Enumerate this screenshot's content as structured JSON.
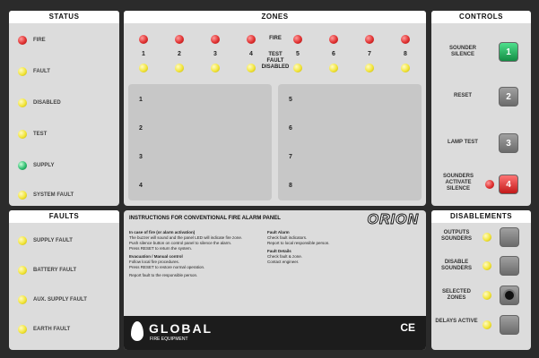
{
  "status": {
    "title": "STATUS",
    "items": [
      {
        "label": "FIRE",
        "color": "#e03131"
      },
      {
        "label": "FAULT",
        "color": "#f2e53a"
      },
      {
        "label": "DISABLED",
        "color": "#f2e53a"
      },
      {
        "label": "TEST",
        "color": "#f2e53a"
      },
      {
        "label": "SUPPLY",
        "color": "#2fbf71"
      },
      {
        "label": "SYSTEM FAULT",
        "color": "#f2e53a"
      }
    ]
  },
  "zones": {
    "title": "ZONES",
    "numbers": [
      "1",
      "2",
      "3",
      "4",
      "5",
      "6",
      "7",
      "8"
    ],
    "fire_label": "FIRE",
    "test_label": "TEST",
    "fault_label": "FAULT",
    "disabled_label": "DISABLED",
    "left_labels": [
      "1",
      "2",
      "3",
      "4"
    ],
    "right_labels": [
      "5",
      "6",
      "7",
      "8"
    ]
  },
  "controls": {
    "title": "CONTROLS",
    "items": [
      {
        "label": "SOUNDER SILENCE",
        "key": "1"
      },
      {
        "label": "RESET",
        "key": "2"
      },
      {
        "label": "LAMP TEST",
        "key": "3"
      },
      {
        "label": "SOUNDERS ACTIVATE SILENCE",
        "key": "4"
      }
    ]
  },
  "faults": {
    "title": "FAULTS",
    "items": [
      {
        "label": "SUPPLY FAULT"
      },
      {
        "label": "BATTERY FAULT"
      },
      {
        "label": "AUX. SUPPLY FAULT"
      },
      {
        "label": "EARTH FAULT"
      }
    ]
  },
  "instructions": {
    "title": "INSTRUCTIONS FOR CONVENTIONAL FIRE ALARM PANEL",
    "brand": "ORION",
    "left_block": [
      "In case of fire (or alarm activation)",
      "The buzzer will sound and the panel LED will indicate fire zone.",
      "Push silence button on control panel to silence the alarm.",
      "Press RESET to return the system.",
      "Evacuation / Manual control",
      "Follow local fire procedures.",
      "Press RESET to restore normal operation.",
      "Report fault to the responsible person."
    ],
    "right_block": [
      "Fault Alarm",
      "Check fault indicators.",
      "Report to local responsible person.",
      "Fault Details",
      "Check fault & zone.",
      "Contact engineer."
    ],
    "company": "GLOBAL",
    "company_sub": "FIRE EQUIPMENT",
    "ce_mark": "CE"
  },
  "disablements": {
    "title": "DISABLEMENTS",
    "items": [
      {
        "label": "OUTPUTS SOUNDERS"
      },
      {
        "label": "DISABLE SOUNDERS"
      },
      {
        "label": "SELECTED ZONES"
      },
      {
        "label": "DELAYS ACTIVE"
      }
    ]
  }
}
